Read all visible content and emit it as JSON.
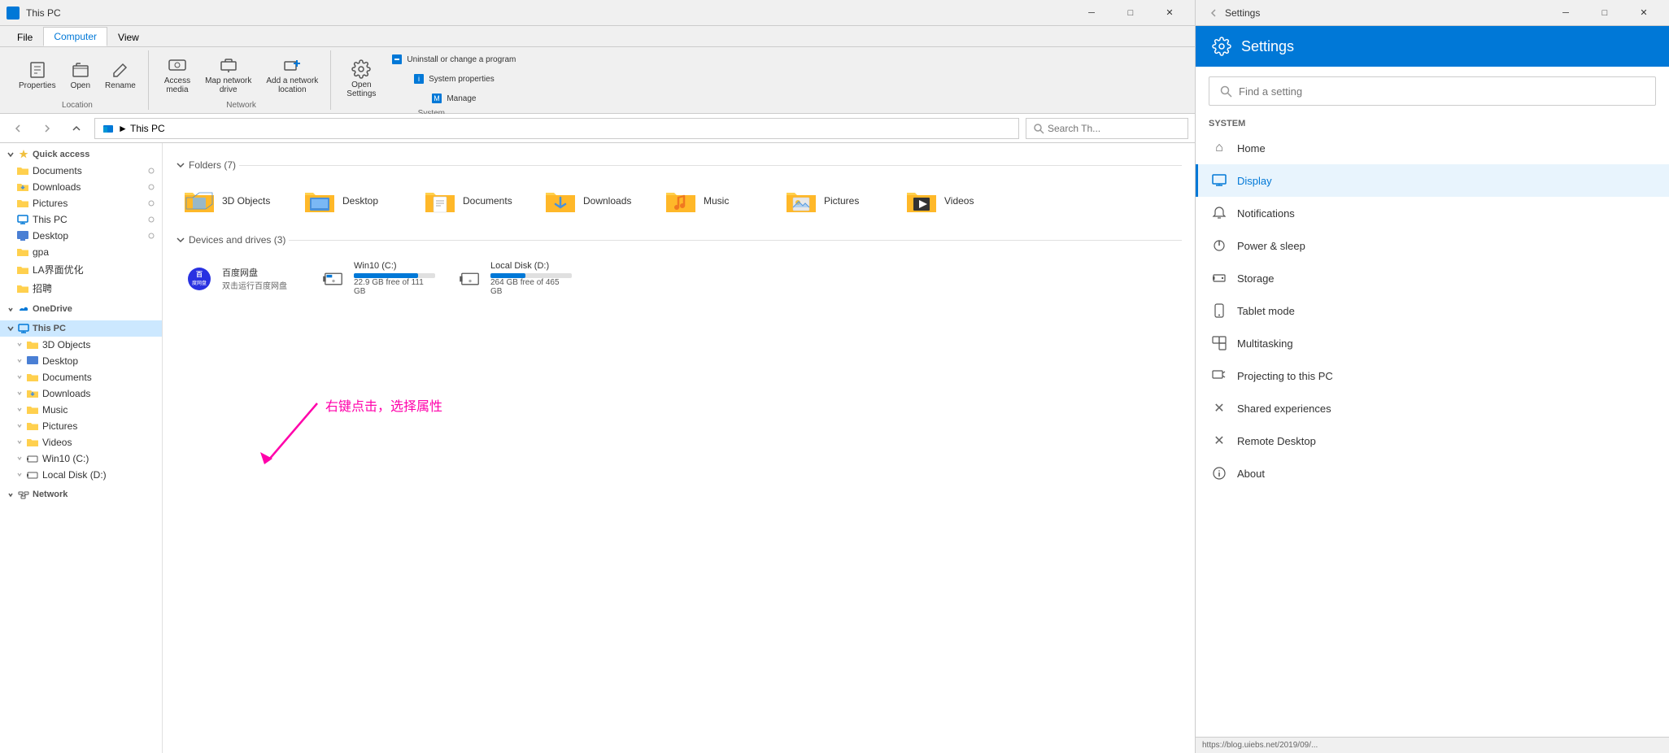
{
  "titlebar": {
    "title": "This PC",
    "minimize": "─",
    "maximize": "□",
    "close": "✕"
  },
  "ribbon": {
    "tabs": [
      "File",
      "Computer",
      "View"
    ],
    "active_tab": "Computer",
    "groups": [
      {
        "label": "Location",
        "buttons": [
          "Properties",
          "Open",
          "Rename"
        ]
      },
      {
        "label": "Network",
        "buttons": [
          "Access media",
          "Map network drive",
          "Add a network location"
        ]
      },
      {
        "label": "System",
        "buttons": [
          "Open Settings",
          "Uninstall or change a program",
          "System properties",
          "Manage"
        ]
      }
    ]
  },
  "addressbar": {
    "path": "This PC",
    "breadcrumb": "► This PC",
    "search_placeholder": "Search Th..."
  },
  "sidebar": {
    "quick_access": {
      "label": "Quick access",
      "items": [
        "Documents",
        "Downloads",
        "Pictures",
        "This PC",
        "Desktop",
        "gpa",
        "LA界面优化",
        "招聘"
      ]
    },
    "onedrive": "OneDrive",
    "this_pc": {
      "label": "This PC",
      "items": [
        "3D Objects",
        "Desktop",
        "Documents",
        "Downloads",
        "Music",
        "Pictures",
        "Videos",
        "Win10 (C:)",
        "Local Disk (D:)"
      ]
    },
    "network": "Network"
  },
  "content": {
    "folders_section": "Folders (7)",
    "folders": [
      {
        "name": "3D Objects",
        "type": "folder3d"
      },
      {
        "name": "Desktop",
        "type": "desktop"
      },
      {
        "name": "Documents",
        "type": "documents"
      },
      {
        "name": "Downloads",
        "type": "downloads"
      },
      {
        "name": "Music",
        "type": "music"
      },
      {
        "name": "Pictures",
        "type": "pictures"
      },
      {
        "name": "Videos",
        "type": "videos"
      }
    ],
    "drives_section": "Devices and drives (3)",
    "drives": [
      {
        "name": "百度网盘",
        "sublabel": "双击运行百度网盘",
        "type": "cloud"
      },
      {
        "name": "Win10 (C:)",
        "free": "22.9 GB free of 111 GB",
        "fill_pct": 79,
        "fill_color": "#0078d7"
      },
      {
        "name": "Local Disk (D:)",
        "free": "264 GB free of 465 GB",
        "fill_pct": 43,
        "fill_color": "#0078d7"
      }
    ]
  },
  "annotation": {
    "text": "右键点击，选择属性",
    "color": "#ff00aa"
  },
  "settings": {
    "title": "Settings",
    "header": "Settings",
    "search_placeholder": "Find a setting",
    "section_label": "System",
    "nav_items": [
      {
        "label": "Home",
        "icon": "⌂",
        "active": false
      },
      {
        "label": "Display",
        "icon": "🖥",
        "active": true
      },
      {
        "label": "Notifications",
        "icon": "🔔",
        "active": false
      },
      {
        "label": "Power & sleep",
        "icon": "⏻",
        "active": false
      },
      {
        "label": "Storage",
        "icon": "💾",
        "active": false
      },
      {
        "label": "Tablet mode",
        "icon": "⬜",
        "active": false
      },
      {
        "label": "Multitasking",
        "icon": "⧉",
        "active": false
      },
      {
        "label": "Projecting to this PC",
        "icon": "📽",
        "active": false
      },
      {
        "label": "Shared experiences",
        "icon": "✕",
        "active": false
      },
      {
        "label": "Remote Desktop",
        "icon": "✕",
        "active": false
      },
      {
        "label": "About",
        "icon": "ℹ",
        "active": false
      }
    ]
  }
}
